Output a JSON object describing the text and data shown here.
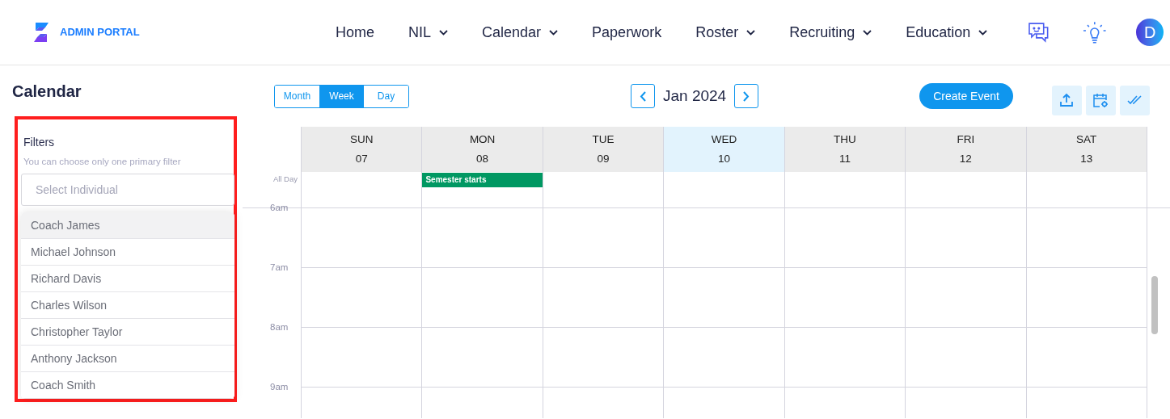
{
  "brand": "ADMIN PORTAL",
  "nav": [
    {
      "label": "Home",
      "dropdown": false
    },
    {
      "label": "NIL",
      "dropdown": true
    },
    {
      "label": "Calendar",
      "dropdown": true
    },
    {
      "label": "Paperwork",
      "dropdown": false
    },
    {
      "label": "Roster",
      "dropdown": true
    },
    {
      "label": "Recruiting",
      "dropdown": true
    },
    {
      "label": "Education",
      "dropdown": true
    }
  ],
  "avatar": "D",
  "page_title": "Calendar",
  "filters": {
    "title": "Filters",
    "hint": "You can choose only one primary filter",
    "placeholder": "Select Individual",
    "options": [
      {
        "label": "Coach James",
        "selected": true
      },
      {
        "label": "Michael Johnson",
        "selected": false
      },
      {
        "label": "Richard Davis",
        "selected": false
      },
      {
        "label": "Charles Wilson",
        "selected": false
      },
      {
        "label": "Christopher Taylor",
        "selected": false
      },
      {
        "label": "Anthony Jackson",
        "selected": false
      },
      {
        "label": "Coach Smith",
        "selected": false
      }
    ]
  },
  "views": [
    {
      "label": "Month",
      "selected": false
    },
    {
      "label": "Week",
      "selected": true
    },
    {
      "label": "Day",
      "selected": false
    }
  ],
  "period": "Jan 2024",
  "create_button": "Create Event",
  "days": [
    {
      "name": "SUN",
      "date": "07",
      "today": false
    },
    {
      "name": "MON",
      "date": "08",
      "today": false,
      "all_day_events": [
        {
          "title": "Semester starts",
          "color": "#009862"
        }
      ]
    },
    {
      "name": "TUE",
      "date": "09",
      "today": false
    },
    {
      "name": "WED",
      "date": "10",
      "today": true
    },
    {
      "name": "THU",
      "date": "11",
      "today": false
    },
    {
      "name": "FRI",
      "date": "12",
      "today": false
    },
    {
      "name": "SAT",
      "date": "13",
      "today": false
    }
  ],
  "all_day_label": "All Day",
  "hours": [
    "6am",
    "7am",
    "8am",
    "9am"
  ]
}
